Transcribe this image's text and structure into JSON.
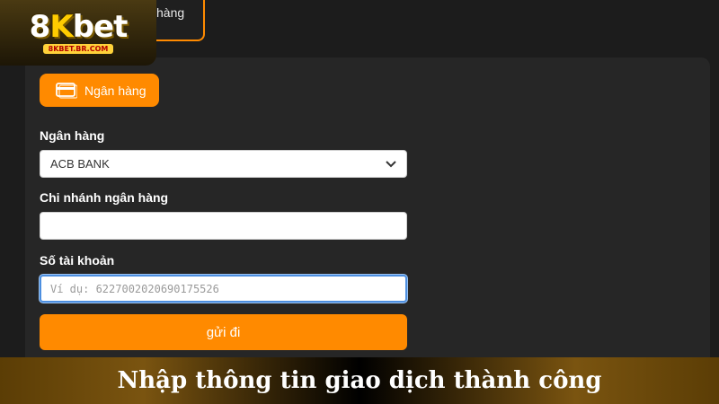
{
  "brand": {
    "logo_prefix": "8",
    "logo_k": "K",
    "logo_suffix": "bet",
    "domain": "8KBET.BR.COM"
  },
  "top_tab": {
    "label": "hàng"
  },
  "payment_method": {
    "label": "Ngân hàng",
    "icon": "card-icon"
  },
  "form": {
    "bank_label": "Ngân hàng",
    "bank_selected": "ACB BANK",
    "branch_label": "Chi nhánh ngân hàng",
    "branch_value": "",
    "account_label": "Số tài khoản",
    "account_placeholder": "Ví dụ: 6227002020690175526",
    "submit_label": "gửi đi"
  },
  "caption": {
    "text": "Nhập thông tin giao dịch thành công"
  },
  "colors": {
    "accent": "#ff8a00",
    "panel": "#262626",
    "background": "#1c1c1c",
    "focus": "#4d8fe0"
  }
}
